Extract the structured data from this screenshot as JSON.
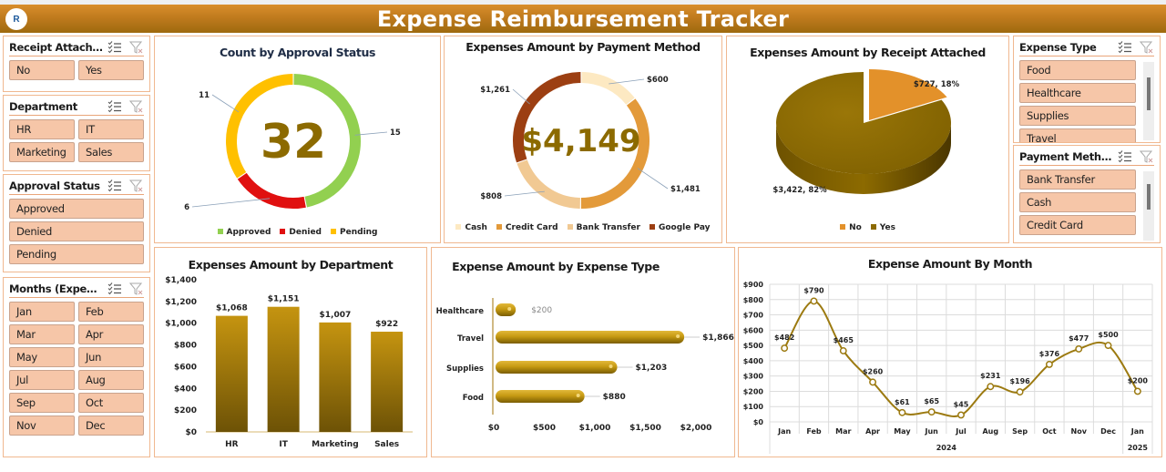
{
  "header": {
    "title": "Expense Reimbursement Tracker",
    "logo_icon": "logo-icon",
    "logo_text": "R"
  },
  "slicers": {
    "receipt_attached": {
      "title": "Receipt Attached",
      "items": [
        "No",
        "Yes"
      ]
    },
    "department": {
      "title": "Department",
      "items": [
        "HR",
        "IT",
        "Marketing",
        "Sales"
      ]
    },
    "approval_status": {
      "title": "Approval Status",
      "items": [
        "Approved",
        "Denied",
        "Pending"
      ]
    },
    "months": {
      "title": "Months (Expense...",
      "items": [
        "Jan",
        "Feb",
        "Mar",
        "Apr",
        "May",
        "Jun",
        "Jul",
        "Aug",
        "Sep",
        "Oct",
        "Nov",
        "Dec"
      ]
    },
    "expense_type": {
      "title": "Expense Type",
      "items": [
        "Food",
        "Healthcare",
        "Supplies",
        "Travel"
      ]
    },
    "payment_method": {
      "title": "Payment Method",
      "items": [
        "Bank Transfer",
        "Cash",
        "Credit Card"
      ]
    }
  },
  "colors": {
    "accent": "#c59410",
    "panel_border": "#f0b890",
    "slicer_button": "#f6c6a8",
    "approved": "#92d050",
    "denied": "#e01010",
    "pending": "#ffc000",
    "cash": "#fde9c2",
    "credit_card": "#e39a3a",
    "bank_transfer": "#f1c993",
    "google_pay": "#9c3f12",
    "receipt_no": "#e3912a",
    "receipt_yes": "#8c6a00",
    "center_number": "#8c6a00"
  },
  "chart_data": [
    {
      "id": "approval",
      "type": "pie",
      "title": "Count by Approval Status",
      "center_label": "32",
      "categories": [
        "Approved",
        "Denied",
        "Pending"
      ],
      "values": [
        15,
        6,
        11
      ],
      "data_labels": [
        "15",
        "6",
        "11"
      ],
      "legend": "bottom"
    },
    {
      "id": "payment",
      "type": "pie",
      "title": "Expenses Amount by Payment Method",
      "center_label": "$4,149",
      "categories": [
        "Cash",
        "Credit Card",
        "Bank Transfer",
        "Google Pay"
      ],
      "values": [
        600,
        1481,
        808,
        1261
      ],
      "data_labels": [
        "$600",
        "$1,481",
        "$808",
        "$1,261"
      ],
      "legend": "bottom"
    },
    {
      "id": "receipt",
      "type": "pie",
      "title": "Expenses Amount by Receipt Attached",
      "categories": [
        "No",
        "Yes"
      ],
      "values": [
        727,
        3422
      ],
      "data_labels": [
        "$727, 18%",
        "$3,422, 82%"
      ],
      "legend": "bottom"
    },
    {
      "id": "department",
      "type": "bar",
      "title": "Expenses Amount by Department",
      "categories": [
        "HR",
        "IT",
        "Marketing",
        "Sales"
      ],
      "values": [
        1068,
        1151,
        1007,
        922
      ],
      "data_labels": [
        "$1,068",
        "$1,151",
        "$1,007",
        "$922"
      ],
      "yticks": [
        "$0",
        "$200",
        "$400",
        "$600",
        "$800",
        "$1,000",
        "$1,200",
        "$1,400"
      ],
      "ylim": [
        0,
        1400
      ],
      "xlabel": "",
      "ylabel": ""
    },
    {
      "id": "expense_type",
      "type": "bar",
      "orientation": "horizontal",
      "title": "Expense Amount by Expense Type",
      "categories": [
        "Healthcare",
        "Travel",
        "Supplies",
        "Food"
      ],
      "values": [
        200,
        1866,
        1203,
        880
      ],
      "data_labels": [
        "$200",
        "$1,866",
        "$1,203",
        "$880"
      ],
      "xticks": [
        "$0",
        "$500",
        "$1,000",
        "$1,500",
        "$2,000"
      ],
      "xlim": [
        0,
        2000
      ]
    },
    {
      "id": "month",
      "type": "line",
      "title": "Expense Amount By Month",
      "categories": [
        "Jan",
        "Feb",
        "Mar",
        "Apr",
        "May",
        "Jun",
        "Jul",
        "Aug",
        "Sep",
        "Oct",
        "Nov",
        "Dec",
        "Jan"
      ],
      "years": [
        {
          "label": "2024",
          "span": 12
        },
        {
          "label": "2025",
          "span": 1
        }
      ],
      "values": [
        482,
        790,
        465,
        260,
        61,
        65,
        45,
        231,
        196,
        376,
        477,
        500,
        200
      ],
      "data_labels": [
        "$482",
        "$790",
        "$465",
        "$260",
        "$61",
        "$65",
        "$45",
        "$231",
        "$196",
        "$376",
        "$477",
        "$500",
        "$200"
      ],
      "yticks": [
        "$0",
        "$100",
        "$200",
        "$300",
        "$400",
        "$500",
        "$600",
        "$700",
        "$800",
        "$900"
      ],
      "ylim": [
        0,
        900
      ],
      "grid": true
    }
  ]
}
